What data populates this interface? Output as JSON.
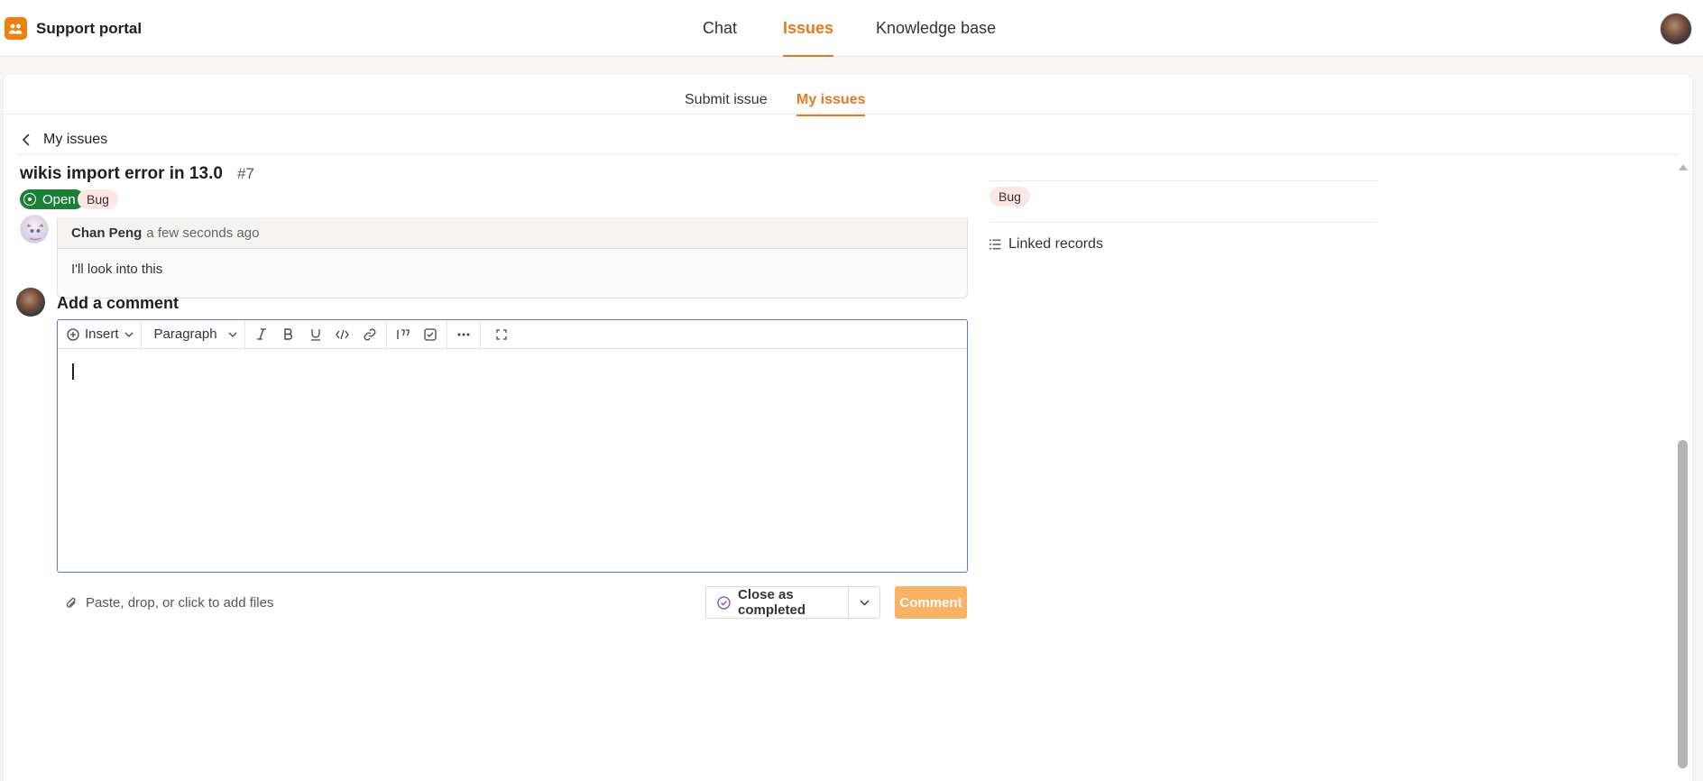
{
  "app": {
    "title": "Support portal"
  },
  "nav": {
    "chat": "Chat",
    "issues": "Issues",
    "knowledge": "Knowledge base"
  },
  "subtabs": {
    "submit": "Submit issue",
    "mine": "My issues"
  },
  "breadcrumb": {
    "back_label": "My issues"
  },
  "issue": {
    "title": "wikis import error in 13.0",
    "number": "#7",
    "status": "Open",
    "tag": "Bug"
  },
  "comments": [
    {
      "author": "Chan Peng",
      "time": "a few seconds ago",
      "body": "I'll look into this"
    }
  ],
  "sidebar": {
    "tag": "Bug",
    "linked_records": "Linked records"
  },
  "composer": {
    "heading": "Add a comment",
    "insert_label": "Insert",
    "format_label": "Paragraph",
    "attach_label": "Paste, drop, or click to add files",
    "close_label": "Close as completed",
    "submit_label": "Comment"
  },
  "colors": {
    "accent": "#e8791d",
    "open_green": "#1a7f37",
    "bug_tag": "#fde6e4",
    "comment_button": "#f9b165",
    "editor_focus": "#4a7ddb"
  }
}
